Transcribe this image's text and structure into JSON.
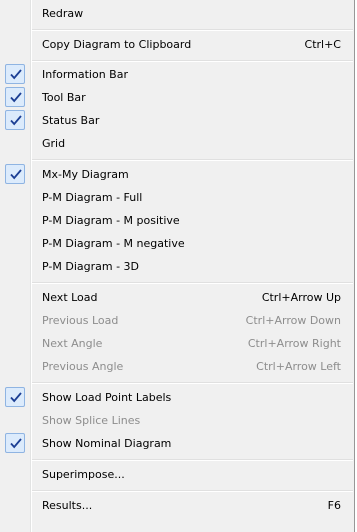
{
  "menu": {
    "accent_check_bg": "#dcebfc",
    "items": [
      {
        "label": "Redraw",
        "shortcut": "",
        "checked": false,
        "enabled": true
      },
      {
        "label": "Copy Diagram to Clipboard",
        "shortcut": "Ctrl+C",
        "checked": false,
        "enabled": true
      },
      {
        "label": "Information Bar",
        "shortcut": "",
        "checked": true,
        "enabled": true
      },
      {
        "label": "Tool Bar",
        "shortcut": "",
        "checked": true,
        "enabled": true
      },
      {
        "label": "Status Bar",
        "shortcut": "",
        "checked": true,
        "enabled": true
      },
      {
        "label": "Grid",
        "shortcut": "",
        "checked": false,
        "enabled": true
      },
      {
        "label": "Mx-My Diagram",
        "shortcut": "",
        "checked": true,
        "enabled": true
      },
      {
        "label": "P-M Diagram - Full",
        "shortcut": "",
        "checked": false,
        "enabled": true
      },
      {
        "label": "P-M Diagram - M positive",
        "shortcut": "",
        "checked": false,
        "enabled": true
      },
      {
        "label": "P-M Diagram - M negative",
        "shortcut": "",
        "checked": false,
        "enabled": true
      },
      {
        "label": "P-M Diagram - 3D",
        "shortcut": "",
        "checked": false,
        "enabled": true
      },
      {
        "label": "Next Load",
        "shortcut": "Ctrl+Arrow Up",
        "checked": false,
        "enabled": true
      },
      {
        "label": "Previous Load",
        "shortcut": "Ctrl+Arrow Down",
        "checked": false,
        "enabled": false
      },
      {
        "label": "Next Angle",
        "shortcut": "Ctrl+Arrow Right",
        "checked": false,
        "enabled": false
      },
      {
        "label": "Previous Angle",
        "shortcut": "Ctrl+Arrow Left",
        "checked": false,
        "enabled": false
      },
      {
        "label": "Show Load Point Labels",
        "shortcut": "",
        "checked": true,
        "enabled": true
      },
      {
        "label": "Show Splice Lines",
        "shortcut": "",
        "checked": false,
        "enabled": false
      },
      {
        "label": "Show Nominal Diagram",
        "shortcut": "",
        "checked": true,
        "enabled": true
      },
      {
        "label": "Superimpose...",
        "shortcut": "",
        "checked": false,
        "enabled": true
      },
      {
        "label": "Results...",
        "shortcut": "F6",
        "checked": false,
        "enabled": true
      }
    ]
  }
}
